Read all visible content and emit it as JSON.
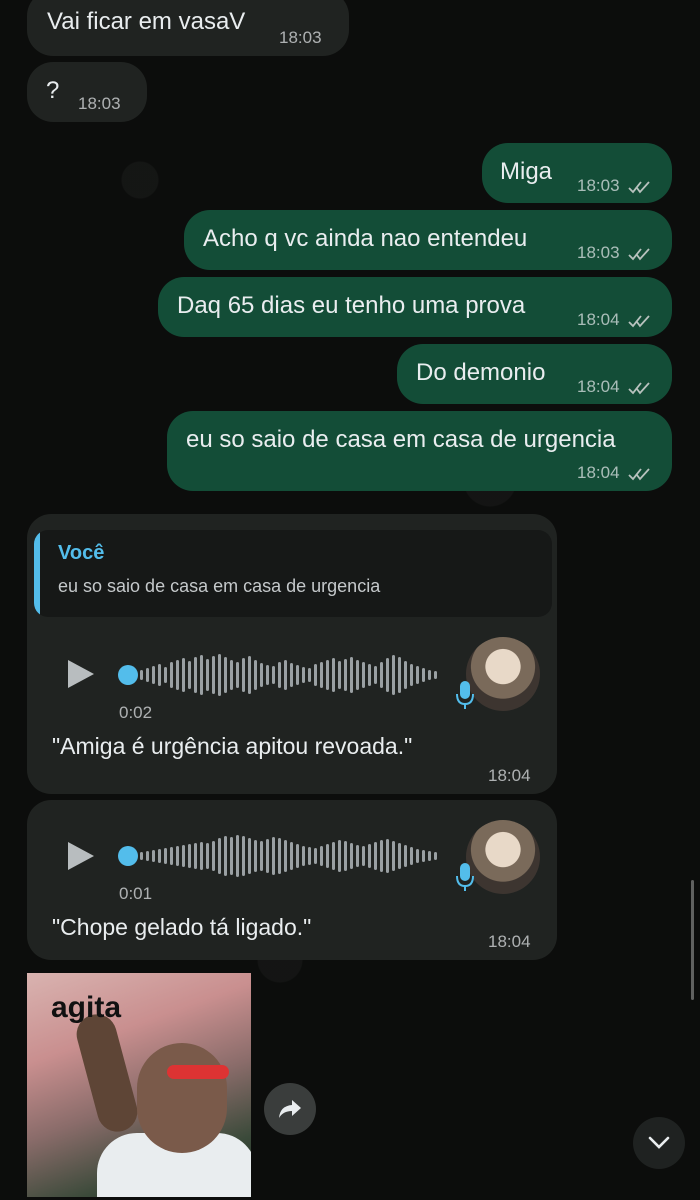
{
  "messages": {
    "m1": {
      "text": "Vai ficar em vasaV",
      "time": "18:03"
    },
    "m2": {
      "text": "?",
      "time": "18:03"
    },
    "m3": {
      "text": "Miga",
      "time": "18:03"
    },
    "m4": {
      "text": "Acho q vc ainda nao entendeu",
      "time": "18:03"
    },
    "m5": {
      "text": "Daq 65 dias eu tenho uma prova",
      "time": "18:04"
    },
    "m6": {
      "text": "Do demonio",
      "time": "18:04"
    },
    "m7": {
      "text": "eu so saio de casa em casa de urgencia",
      "time": "18:04"
    }
  },
  "voice1": {
    "quote_name": "Você",
    "quote_text": "eu so saio de casa em casa de urgencia",
    "duration": "0:02",
    "transcript": "\"Amiga é urgência apitou revoada.\"",
    "time": "18:04"
  },
  "voice2": {
    "duration": "0:01",
    "transcript": "\"Chope gelado tá ligado.\"",
    "time": "18:04"
  },
  "sticker": {
    "text": "agita"
  },
  "icons": {
    "play": "play-icon",
    "mic": "microphone-icon",
    "forward": "forward-icon",
    "scroll_down": "chevron-down-icon",
    "read": "double-check-icon"
  },
  "colors": {
    "incoming": "#202321",
    "outgoing": "#134d37",
    "accent": "#53bdeb"
  }
}
